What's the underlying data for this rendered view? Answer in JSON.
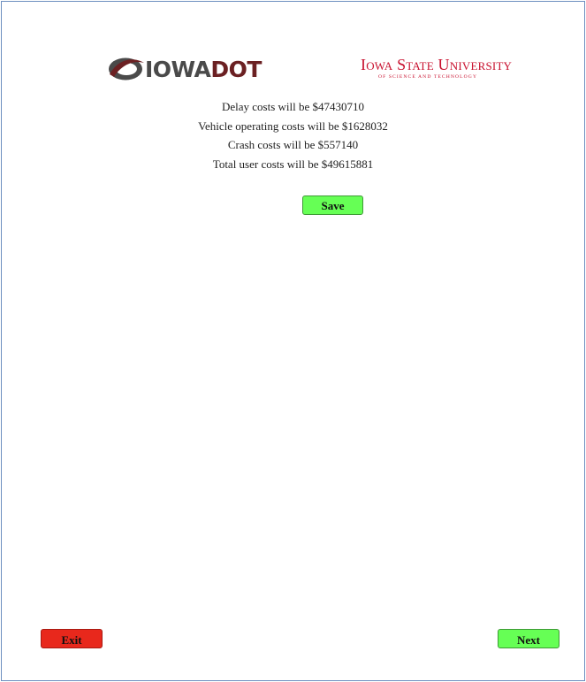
{
  "header": {
    "dot_logo": {
      "word_iowa": "IOWA",
      "word_dot": "DOT",
      "icon": "iowa-dot-swoosh-icon"
    },
    "isu_logo": {
      "name": "Iowa State University",
      "tagline": "OF SCIENCE AND TECHNOLOGY"
    }
  },
  "results": {
    "delay": "Delay costs will be $47430710",
    "vehicle": "Vehicle operating costs will be $1628032",
    "crash": "Crash costs will be $557140",
    "total": "Total user costs will be $49615881"
  },
  "buttons": {
    "save": "Save",
    "exit": "Exit",
    "next": "Next"
  },
  "colors": {
    "green_button": "#66ff55",
    "red_button": "#e8281c",
    "dot_maroon": "#6b2022",
    "isu_red": "#c8102e"
  }
}
